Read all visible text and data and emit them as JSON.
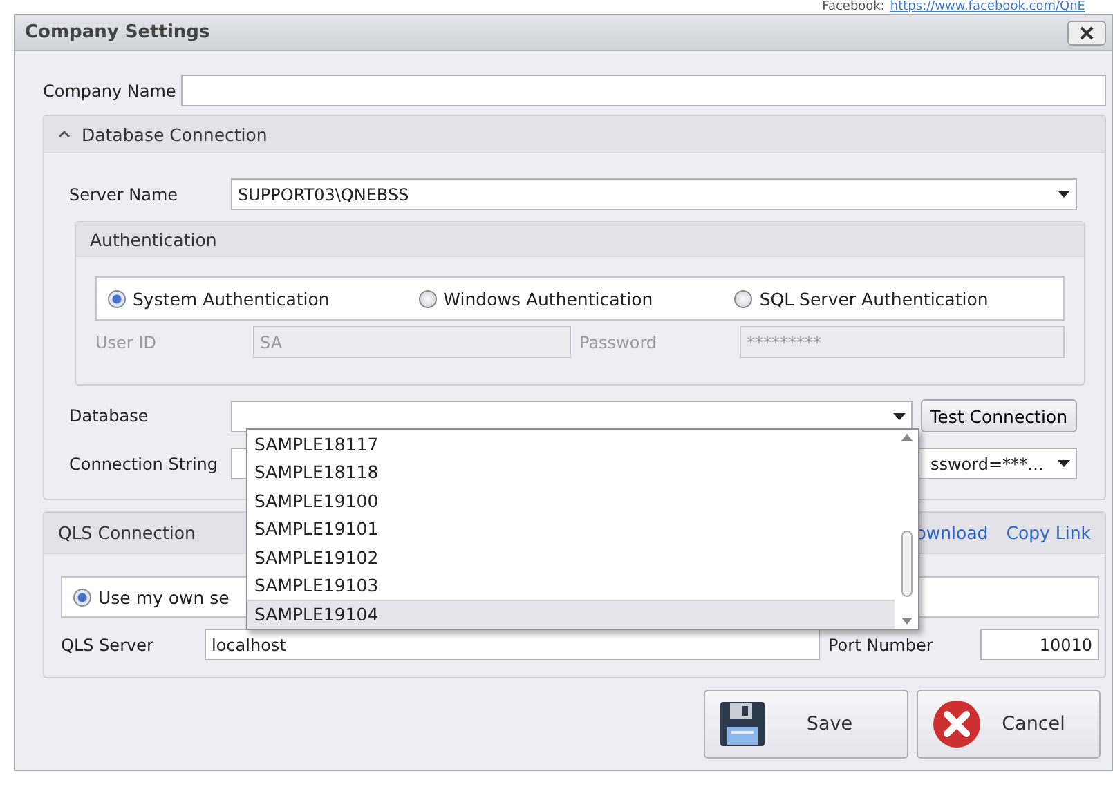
{
  "background": {
    "label": "Facebook:",
    "link": "https://www.facebook.com/QnE"
  },
  "window": {
    "title": "Company Settings"
  },
  "company_name": {
    "label": "Company Name"
  },
  "database_connection": {
    "title": "Database Connection",
    "expanded": true,
    "server_name": {
      "label": "Server Name",
      "value": "SUPPORT03\\QNEBSS"
    },
    "authentication": {
      "title": "Authentication",
      "options": [
        {
          "label": "System Authentication",
          "selected": true
        },
        {
          "label": "Windows Authentication",
          "selected": false
        },
        {
          "label": "SQL Server Authentication",
          "selected": false
        }
      ],
      "user_id": {
        "label": "User ID",
        "value": "SA",
        "disabled": true
      },
      "password": {
        "label": "Password",
        "value": "*********",
        "disabled": true
      }
    },
    "database": {
      "label": "Database",
      "open": true,
      "items": [
        {
          "label": "SAMPLE18117",
          "selected": false
        },
        {
          "label": "SAMPLE18118",
          "selected": false
        },
        {
          "label": "SAMPLE19100",
          "selected": false
        },
        {
          "label": "SAMPLE19101",
          "selected": false
        },
        {
          "label": "SAMPLE19102",
          "selected": false
        },
        {
          "label": "SAMPLE19103",
          "selected": false
        },
        {
          "label": "SAMPLE19104",
          "selected": true
        }
      ]
    },
    "test_button": "Test Connection",
    "connection_string": {
      "label": "Connection String",
      "value": "ssword=***…"
    }
  },
  "qls_connection": {
    "title": "QLS Connection",
    "links": [
      "ownload",
      "Copy Link"
    ],
    "option": {
      "label": "Use my own se",
      "selected": true
    },
    "server": {
      "label": "QLS Server",
      "value": "localhost"
    },
    "port": {
      "label": "Port Number",
      "value": "10010"
    }
  },
  "buttons": [
    {
      "kind": "save",
      "label": "Save"
    },
    {
      "kind": "cancel",
      "label": "Cancel"
    }
  ]
}
